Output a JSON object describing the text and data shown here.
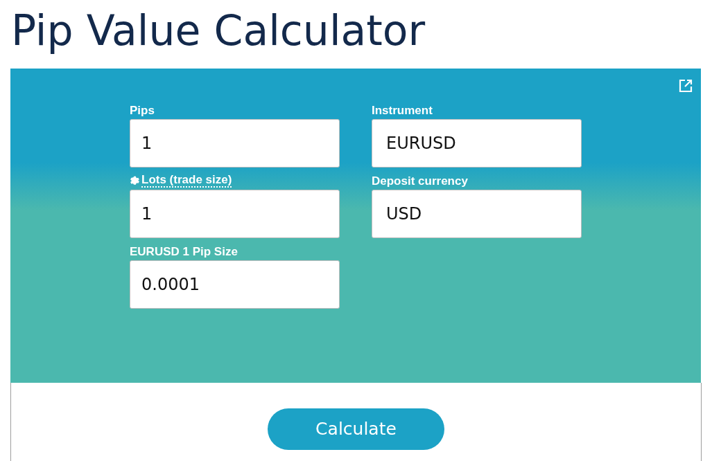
{
  "title": "Pip Value Calculator",
  "fields": [
    {
      "label": "Pips",
      "value": "1",
      "tooltip": false
    },
    {
      "label": "Instrument",
      "value": "EURUSD",
      "tooltip": false
    },
    {
      "label": "Lots (trade size)",
      "value": "1",
      "tooltip": true
    },
    {
      "label": "Deposit currency",
      "value": "USD",
      "tooltip": false
    },
    {
      "label": "EURUSD 1 Pip Size",
      "value": "0.0001",
      "tooltip": false
    }
  ],
  "button": "Calculate"
}
